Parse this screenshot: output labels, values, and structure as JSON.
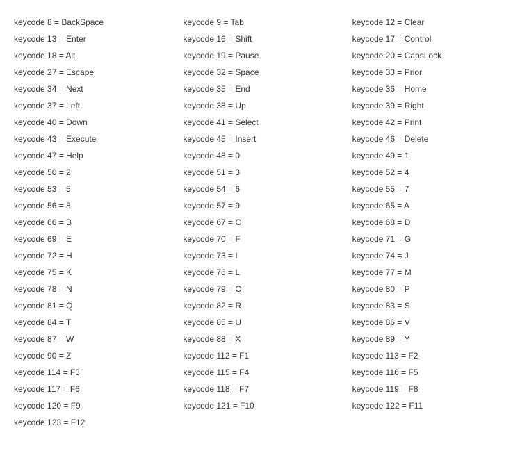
{
  "keycodes": [
    {
      "code": 8,
      "name": "BackSpace"
    },
    {
      "code": 9,
      "name": "Tab"
    },
    {
      "code": 12,
      "name": "Clear"
    },
    {
      "code": 13,
      "name": "Enter"
    },
    {
      "code": 16,
      "name": "Shift"
    },
    {
      "code": 17,
      "name": "Control"
    },
    {
      "code": 18,
      "name": "Alt"
    },
    {
      "code": 19,
      "name": "Pause"
    },
    {
      "code": 20,
      "name": "CapsLock"
    },
    {
      "code": 27,
      "name": "Escape"
    },
    {
      "code": 32,
      "name": "Space"
    },
    {
      "code": 33,
      "name": "Prior"
    },
    {
      "code": 34,
      "name": "Next"
    },
    {
      "code": 35,
      "name": "End"
    },
    {
      "code": 36,
      "name": "Home"
    },
    {
      "code": 37,
      "name": "Left"
    },
    {
      "code": 38,
      "name": "Up"
    },
    {
      "code": 39,
      "name": "Right"
    },
    {
      "code": 40,
      "name": "Down"
    },
    {
      "code": 41,
      "name": "Select"
    },
    {
      "code": 42,
      "name": "Print"
    },
    {
      "code": 43,
      "name": "Execute"
    },
    {
      "code": 45,
      "name": "Insert"
    },
    {
      "code": 46,
      "name": "Delete"
    },
    {
      "code": 47,
      "name": "Help"
    },
    {
      "code": 48,
      "name": "0"
    },
    {
      "code": 49,
      "name": "1"
    },
    {
      "code": 50,
      "name": "2"
    },
    {
      "code": 51,
      "name": "3"
    },
    {
      "code": 52,
      "name": "4"
    },
    {
      "code": 53,
      "name": "5"
    },
    {
      "code": 54,
      "name": "6"
    },
    {
      "code": 55,
      "name": "7"
    },
    {
      "code": 56,
      "name": "8"
    },
    {
      "code": 57,
      "name": "9"
    },
    {
      "code": 65,
      "name": "A"
    },
    {
      "code": 66,
      "name": "B"
    },
    {
      "code": 67,
      "name": "C"
    },
    {
      "code": 68,
      "name": "D"
    },
    {
      "code": 69,
      "name": "E"
    },
    {
      "code": 70,
      "name": "F"
    },
    {
      "code": 71,
      "name": "G"
    },
    {
      "code": 72,
      "name": "H"
    },
    {
      "code": 73,
      "name": "I"
    },
    {
      "code": 74,
      "name": "J"
    },
    {
      "code": 75,
      "name": "K"
    },
    {
      "code": 76,
      "name": "L"
    },
    {
      "code": 77,
      "name": "M"
    },
    {
      "code": 78,
      "name": "N"
    },
    {
      "code": 79,
      "name": "O"
    },
    {
      "code": 80,
      "name": "P"
    },
    {
      "code": 81,
      "name": "Q"
    },
    {
      "code": 82,
      "name": "R"
    },
    {
      "code": 83,
      "name": "S"
    },
    {
      "code": 84,
      "name": "T"
    },
    {
      "code": 85,
      "name": "U"
    },
    {
      "code": 86,
      "name": "V"
    },
    {
      "code": 87,
      "name": "W"
    },
    {
      "code": 88,
      "name": "X"
    },
    {
      "code": 89,
      "name": "Y"
    },
    {
      "code": 90,
      "name": "Z"
    },
    {
      "code": 112,
      "name": "F1"
    },
    {
      "code": 113,
      "name": "F2"
    },
    {
      "code": 114,
      "name": "F3"
    },
    {
      "code": 115,
      "name": "F4"
    },
    {
      "code": 116,
      "name": "F5"
    },
    {
      "code": 117,
      "name": "F6"
    },
    {
      "code": 118,
      "name": "F7"
    },
    {
      "code": 119,
      "name": "F8"
    },
    {
      "code": 120,
      "name": "F9"
    },
    {
      "code": 121,
      "name": "F10"
    },
    {
      "code": 122,
      "name": "F11"
    },
    {
      "code": 123,
      "name": "F12"
    }
  ]
}
